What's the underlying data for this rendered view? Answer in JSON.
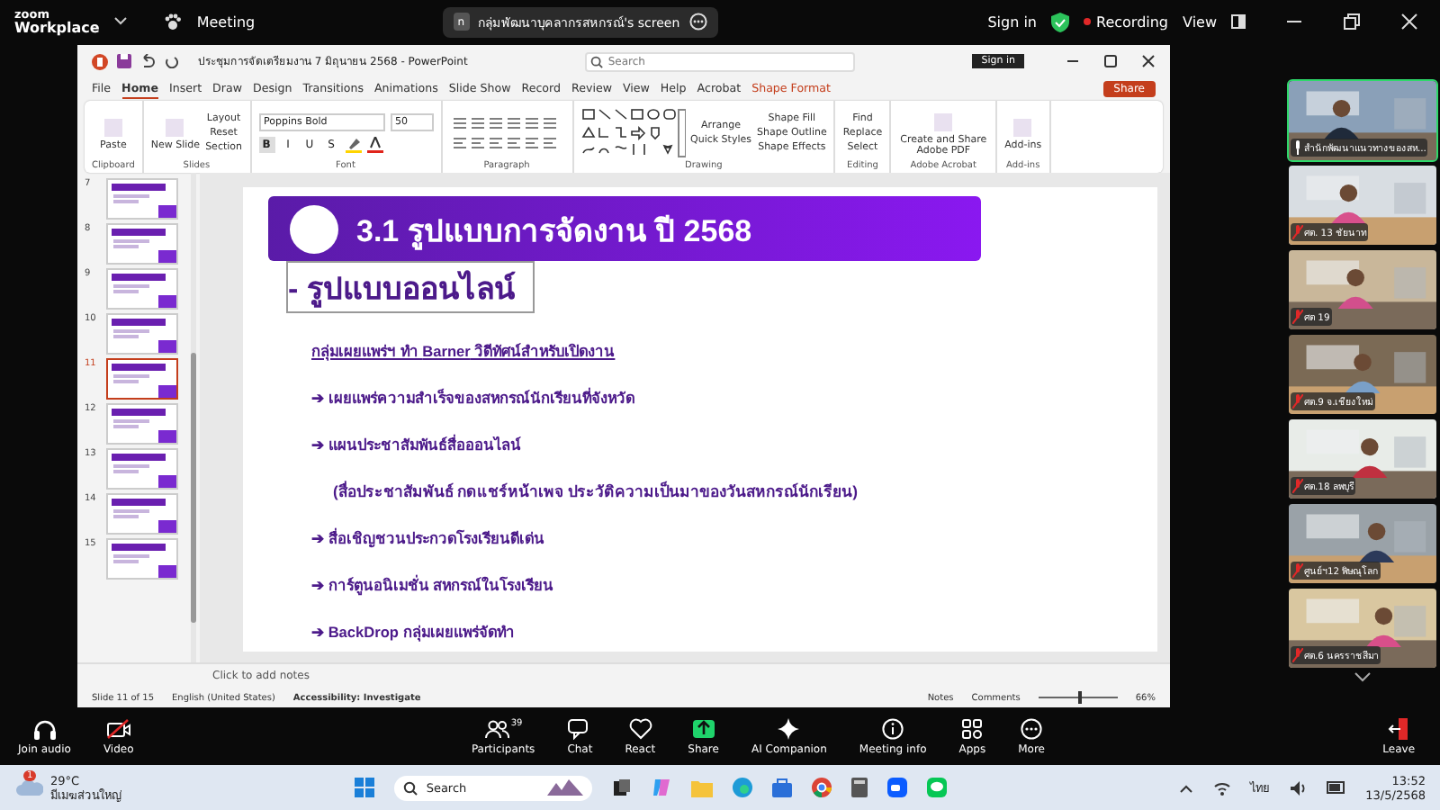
{
  "zoom_top": {
    "app_line1": "zoom",
    "app_line2": "Workplace",
    "meeting": "Meeting",
    "share_avatar": "n",
    "share_banner": "กลุ่มพัฒนาบุคลากรสหกรณ์'s screen",
    "sign_in": "Sign in",
    "recording": "Recording",
    "view": "View"
  },
  "powerpoint": {
    "title": "ประชุมการจัดเตรียมงาน 7 มิถุนายน 2568  -  PowerPoint",
    "search": {
      "placeholder": "Search"
    },
    "sign_in": "Sign in",
    "tabs": [
      {
        "label": "File",
        "selected": false,
        "kind": "normal"
      },
      {
        "label": "Home",
        "selected": true,
        "kind": "normal"
      },
      {
        "label": "Insert",
        "selected": false,
        "kind": "normal"
      },
      {
        "label": "Draw",
        "selected": false,
        "kind": "normal"
      },
      {
        "label": "Design",
        "selected": false,
        "kind": "normal"
      },
      {
        "label": "Transitions",
        "selected": false,
        "kind": "normal"
      },
      {
        "label": "Animations",
        "selected": false,
        "kind": "normal"
      },
      {
        "label": "Slide Show",
        "selected": false,
        "kind": "normal"
      },
      {
        "label": "Record",
        "selected": false,
        "kind": "normal"
      },
      {
        "label": "Review",
        "selected": false,
        "kind": "normal"
      },
      {
        "label": "View",
        "selected": false,
        "kind": "normal"
      },
      {
        "label": "Help",
        "selected": false,
        "kind": "normal"
      },
      {
        "label": "Acrobat",
        "selected": false,
        "kind": "normal"
      },
      {
        "label": "Shape Format",
        "selected": false,
        "kind": "contextual"
      }
    ],
    "share": "Share",
    "ribbon": [
      {
        "label": "Clipboard",
        "buttons": [
          "Paste"
        ]
      },
      {
        "label": "Slides",
        "buttons": [
          "New Slide",
          "Layout",
          "Reset",
          "Section"
        ]
      },
      {
        "label": "Font",
        "font": "Poppins Bold",
        "size": "50",
        "buttons": [
          "B",
          "I",
          "U",
          "S"
        ]
      },
      {
        "label": "Paragraph"
      },
      {
        "label": "Drawing",
        "buttons": [
          "Arrange",
          "Quick Styles",
          "Shape Fill",
          "Shape Outline",
          "Shape Effects"
        ]
      },
      {
        "label": "Editing",
        "buttons": [
          "Find",
          "Replace",
          "Select"
        ]
      },
      {
        "label": "Adobe Acrobat",
        "buttons": [
          "Create and Share Adobe PDF"
        ]
      },
      {
        "label": "Add-ins",
        "buttons": [
          "Add-ins"
        ]
      }
    ],
    "thumbnails": [
      {
        "number": "7",
        "selected": false
      },
      {
        "number": "8",
        "selected": false
      },
      {
        "number": "9",
        "selected": false
      },
      {
        "number": "10",
        "selected": false
      },
      {
        "number": "11",
        "selected": true
      },
      {
        "number": "12",
        "selected": false
      },
      {
        "number": "13",
        "selected": false
      },
      {
        "number": "14",
        "selected": false
      },
      {
        "number": "15",
        "selected": false
      }
    ],
    "slide": {
      "title": "3.1 รูปแบบการจัดงาน ปี 2568",
      "subtitle": "- รูปแบบออนไลน์",
      "lines": [
        {
          "kind": "intro",
          "text": "กลุ่มเผยแพร่ฯ ทำ **Barner**  วิดีทัศน์สำหรับเปิดงาน"
        },
        {
          "kind": "bullet",
          "text": "➔ เผยแพร่ความสำเร็จของสหกรณ์นักเรียนที่จังหวัด"
        },
        {
          "kind": "bullet",
          "text": "➔ แผนประชาสัมพันธ์สื่อออนไลน์"
        },
        {
          "kind": "note",
          "text": "(สื่อประชาสัมพันธ์ กดแชร์หน้าเพจ ประวัติความเป็นมาของวันสหกรณ์นักเรียน)"
        },
        {
          "kind": "bullet",
          "text": "➔ สื่อเชิญชวนประกวดโรงเรียนดีเด่น"
        },
        {
          "kind": "bullet",
          "text": "➔ การ์ตูนอนิเมชั่น สหกรณ์ในโรงเรียน"
        },
        {
          "kind": "bullet",
          "text": "➔ **BackDrop** กลุ่มเผยแพร่จัดทำ"
        }
      ]
    },
    "notes_placeholder": "Click to add notes",
    "status": {
      "slide": "Slide 11 of 15",
      "language": "English (United States)",
      "accessibility": "Accessibility: Investigate",
      "notes": "Notes",
      "comments": "Comments",
      "zoom": "66%",
      "level": 0.5
    }
  },
  "videos": [
    {
      "name": "สำนักพัฒนาแนวทางของสห...",
      "muted": false,
      "speaking": true
    },
    {
      "name": "ศต. 13 ชัยนาท",
      "muted": true,
      "speaking": false
    },
    {
      "name": "ศต 19",
      "muted": true,
      "speaking": false
    },
    {
      "name": "ศต.9 จ.เชียงใหม่",
      "muted": true,
      "speaking": false
    },
    {
      "name": "ศต.18 ลพบุรี",
      "muted": true,
      "speaking": false
    },
    {
      "name": "ศูนย์ฯ12 พิษณุโลก",
      "muted": true,
      "speaking": false
    },
    {
      "name": "ศต.6 นครราชสีมา",
      "muted": true,
      "speaking": false
    }
  ],
  "toolbar": [
    {
      "label": "Join audio",
      "kind": "audio"
    },
    {
      "label": "Video",
      "kind": "video"
    },
    {
      "label": "Participants",
      "kind": "participants",
      "count": "39"
    },
    {
      "label": "Chat",
      "kind": "chat"
    },
    {
      "label": "React",
      "kind": "react"
    },
    {
      "label": "Share",
      "kind": "share"
    },
    {
      "label": "AI Companion",
      "kind": "ai"
    },
    {
      "label": "Meeting info",
      "kind": "info"
    },
    {
      "label": "Apps",
      "kind": "apps"
    },
    {
      "label": "More",
      "kind": "more"
    },
    {
      "label": "Leave",
      "kind": "leave"
    }
  ],
  "taskbar": {
    "badge": "1",
    "temperature": "29°C",
    "weather": "มีเมฆส่วนใหญ่",
    "search": "Search",
    "language": "ไทย",
    "time": "13:52",
    "date": "13/5/2568"
  }
}
